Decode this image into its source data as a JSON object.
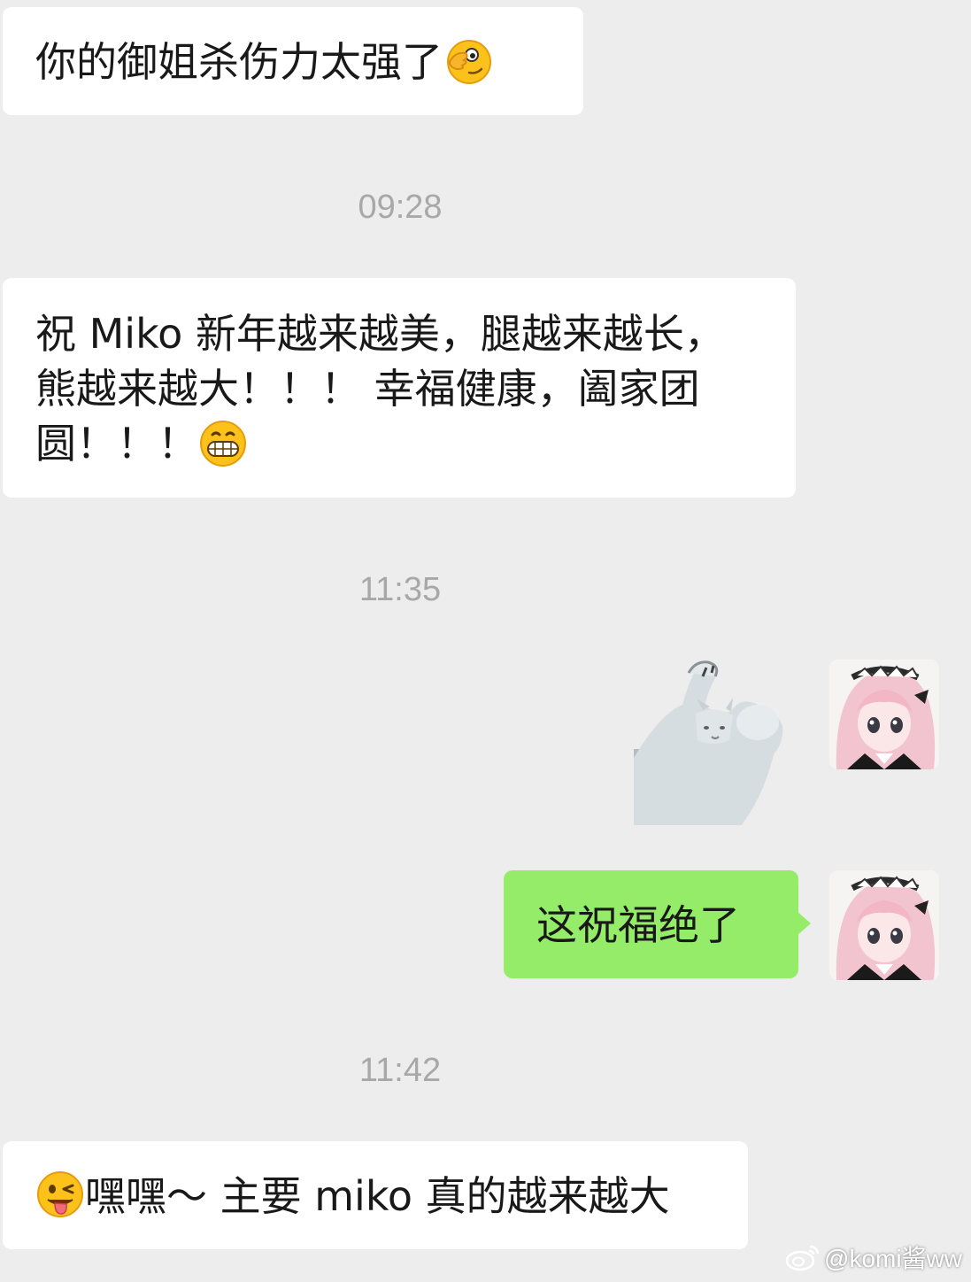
{
  "messages": [
    {
      "side": "left",
      "text": "你的御姐杀伤力太强了",
      "emoji": "face-peeking-wink"
    },
    {
      "time": "09:28"
    },
    {
      "side": "left",
      "text": "祝 Miko 新年越来越美，腿越来越长，\n熊越来越大！！！ 幸福健康，阖家团\n圆！！！",
      "emoji": "grinning-face"
    },
    {
      "time": "11:35"
    },
    {
      "side": "right",
      "type": "sticker",
      "sticker": "white-cat-dancing"
    },
    {
      "side": "right",
      "text": "这祝福绝了"
    },
    {
      "time": "11:42"
    },
    {
      "side": "left",
      "text": "嘿嘿～ 主要 miko 真的越来越大",
      "emoji": "winking-face-tongue"
    }
  ],
  "watermark": "@komi酱ww",
  "colors": {
    "background": "#ededed",
    "bubble_received": "#ffffff",
    "bubble_sent": "#95ec69",
    "timestamp": "#a8a8a8"
  }
}
